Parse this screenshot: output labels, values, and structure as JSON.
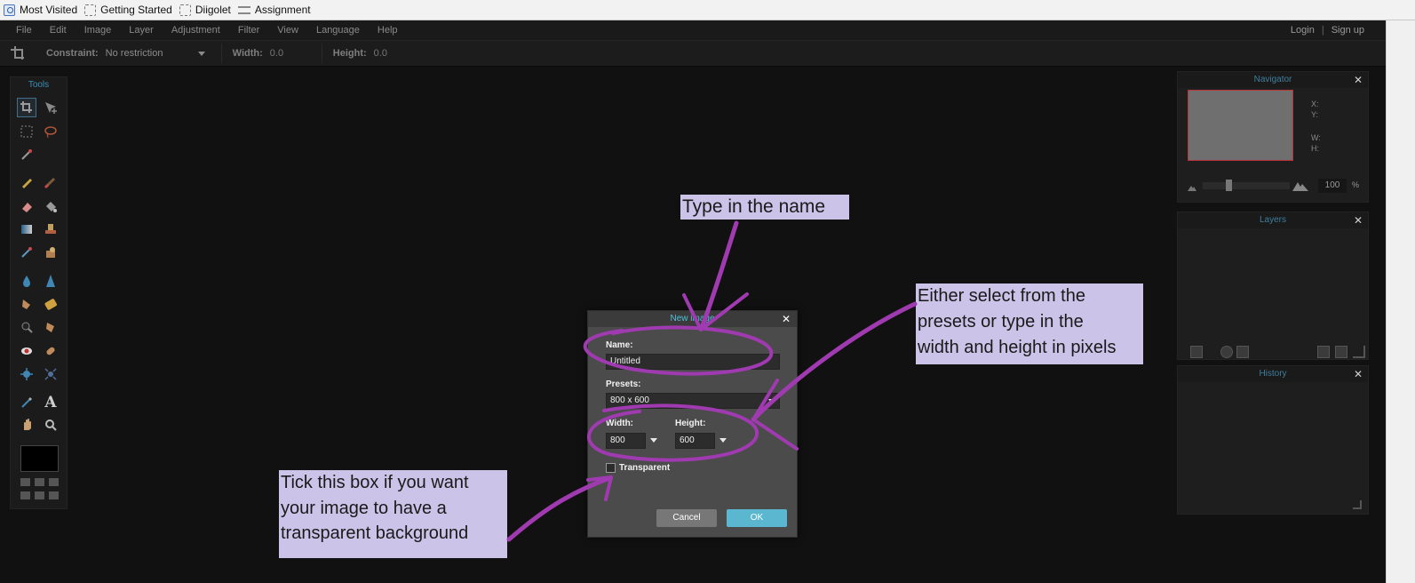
{
  "bookmarks": [
    {
      "label": "Most Visited",
      "icon": "most-visited-icon"
    },
    {
      "label": "Getting Started",
      "icon": "bookmark-page-icon"
    },
    {
      "label": "Diigolet",
      "icon": "bookmark-page-icon"
    },
    {
      "label": "Assignment",
      "icon": "bookmark-wave-icon"
    }
  ],
  "menu": [
    "File",
    "Edit",
    "Image",
    "Layer",
    "Adjustment",
    "Filter",
    "View",
    "Language",
    "Help"
  ],
  "auth": {
    "login": "Login",
    "separator": "|",
    "signup": "Sign up"
  },
  "options": {
    "constraint_label": "Constraint:",
    "constraint_value": "No restriction",
    "width_label": "Width:",
    "width_value": "0.0",
    "height_label": "Height:",
    "height_value": "0.0"
  },
  "tools": {
    "title": "Tools"
  },
  "navigator": {
    "title": "Navigator",
    "x_label": "X:",
    "y_label": "Y:",
    "w_label": "W:",
    "h_label": "H:",
    "zoom": "100",
    "zoom_unit": "%"
  },
  "layers": {
    "title": "Layers"
  },
  "history": {
    "title": "History"
  },
  "dialog": {
    "title": "New image",
    "name_label": "Name:",
    "name_value": "Untitled",
    "presets_label": "Presets:",
    "presets_value": "800 x 600",
    "width_label": "Width:",
    "width_value": "800",
    "height_label": "Height:",
    "height_value": "600",
    "transparent_label": "Transparent",
    "cancel_label": "Cancel",
    "ok_label": "OK"
  },
  "annotations": {
    "name": "Type in the name",
    "presets_lines": [
      "Either select from the",
      "presets or type in the",
      "width and height in pixels"
    ],
    "transparent_lines": [
      "Tick this box if you want",
      "your image to have a",
      "transparent background"
    ],
    "color": "#a03ab0"
  },
  "colors": {
    "accent": "#5bb7d0",
    "panel_title": "#3f7e9b",
    "background": "#111111",
    "callout": "#cbc3e8"
  }
}
